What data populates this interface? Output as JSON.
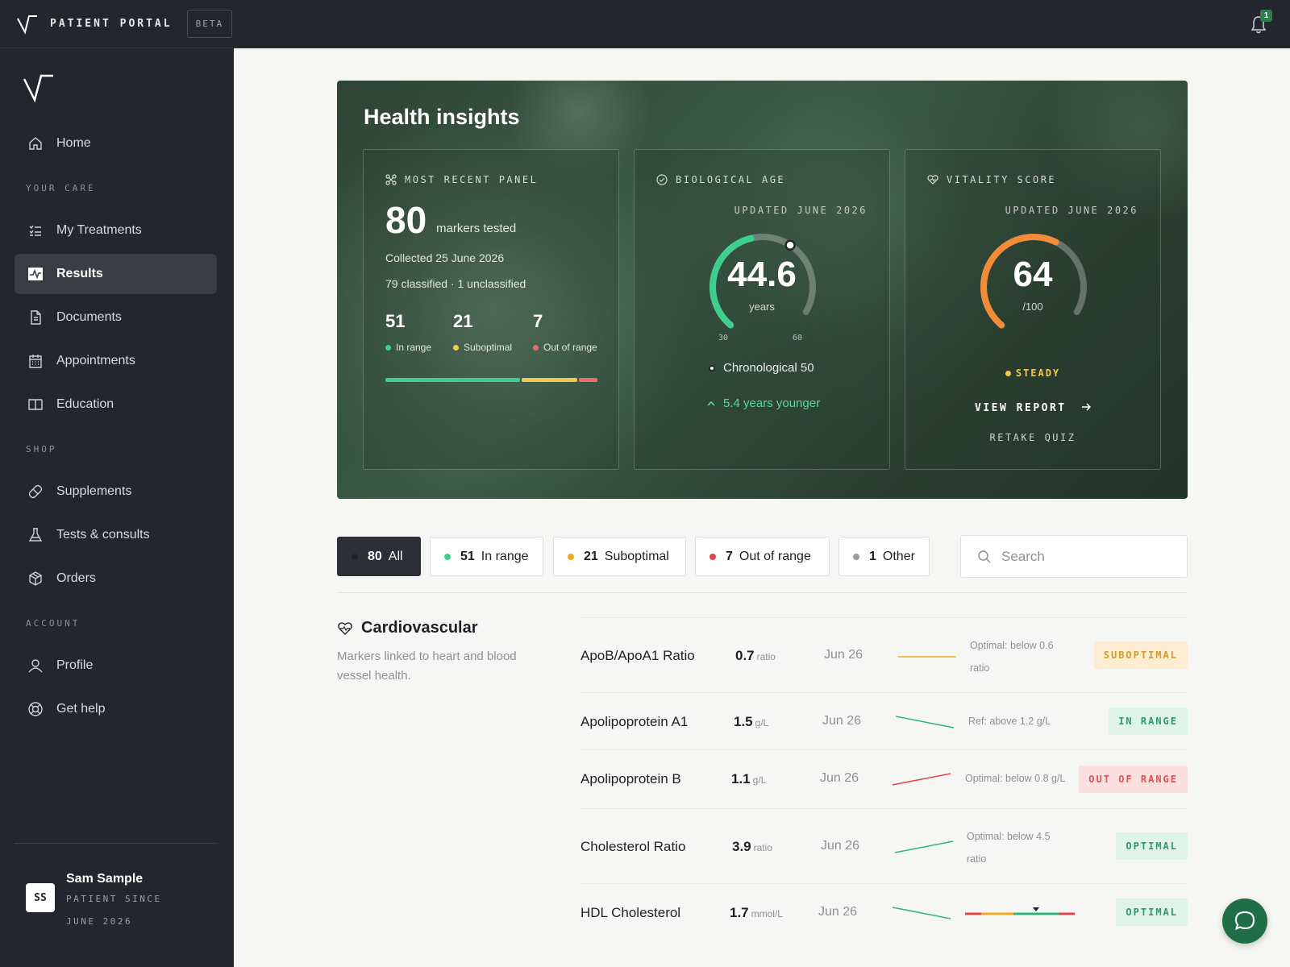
{
  "topbar": {
    "brand": "PATIENT PORTAL",
    "beta": "BETA",
    "notifications": "1"
  },
  "sidebar": {
    "items": [
      {
        "label": "Home",
        "icon": "home-icon"
      },
      {
        "label": "My Treatments",
        "icon": "list-icon"
      },
      {
        "label": "Results",
        "icon": "activity-icon",
        "active": true
      },
      {
        "label": "Documents",
        "icon": "document-icon"
      },
      {
        "label": "Appointments",
        "icon": "calendar-icon"
      },
      {
        "label": "Education",
        "icon": "book-icon"
      },
      {
        "label": "Supplements",
        "icon": "pill-icon"
      },
      {
        "label": "Tests & consults",
        "icon": "flask-icon"
      },
      {
        "label": "Orders",
        "icon": "box-icon"
      },
      {
        "label": "Profile",
        "icon": "user-icon"
      },
      {
        "label": "Get help",
        "icon": "lifebuoy-icon"
      }
    ],
    "sections": [
      "YOUR CARE",
      "SHOP",
      "ACCOUNT"
    ],
    "user": {
      "initials": "SS",
      "name": "Sam Sample",
      "since": "PATIENT SINCE JUNE 2026"
    }
  },
  "hero": {
    "title": "Health insights",
    "panel": {
      "header": "MOST RECENT PANEL",
      "count": "80",
      "count_label": "markers tested",
      "collected": "Collected 25 June 2026",
      "classified": "79 classified · 1 unclassified",
      "stats": [
        {
          "value": "51",
          "label": "In range",
          "color": "#3ecf8e"
        },
        {
          "value": "21",
          "label": "Suboptimal",
          "color": "#f2c94c"
        },
        {
          "value": "7",
          "label": "Out of range",
          "color": "#eb6b6b"
        }
      ]
    },
    "bio_age": {
      "header": "BIOLOGICAL AGE",
      "updated": "UPDATED JUNE 2026",
      "value": "44.6",
      "unit": "years",
      "min": "30",
      "max": "60",
      "chronological": "Chronological 50",
      "younger": "5.4 years younger",
      "gauge_fraction": 0.487,
      "color": "#3ecf8e"
    },
    "vitality": {
      "header": "VITALITY SCORE",
      "updated": "UPDATED JUNE 2026",
      "value": "64",
      "unit": "/100",
      "status": "STEADY",
      "view_report": "VIEW REPORT",
      "retake": "RETAKE QUIZ",
      "gauge_fraction": 0.64,
      "color": "#f28c38"
    }
  },
  "filters": [
    {
      "count": "80",
      "label": "All",
      "color": "#1d2026",
      "active": true
    },
    {
      "count": "51",
      "label": "In range",
      "color": "#3ecf8e"
    },
    {
      "count": "21",
      "label": "Suboptimal",
      "color": "#f0a81e"
    },
    {
      "count": "7",
      "label": "Out of range",
      "color": "#e0454c"
    },
    {
      "count": "1",
      "label": "Other",
      "color": "#9a9ea4"
    }
  ],
  "search": {
    "placeholder": "Search"
  },
  "category": {
    "title": "Cardiovascular",
    "description": "Markers linked to heart and blood vessel health.",
    "markers": [
      {
        "name": "ApoB/ApoA1 Ratio",
        "value": "0.7",
        "unit": "ratio",
        "date": "Jun 26",
        "ref": "Optimal: below 0.6 ratio",
        "status": "SUBOPTIMAL"
      },
      {
        "name": "Apolipoprotein A1",
        "value": "1.5",
        "unit": "g/L",
        "date": "Jun 26",
        "ref": "Ref: above 1.2 g/L",
        "status": "IN RANGE"
      },
      {
        "name": "Apolipoprotein B",
        "value": "1.1",
        "unit": "g/L",
        "date": "Jun 26",
        "ref": "Optimal: below 0.8 g/L",
        "status": "OUT OF RANGE"
      },
      {
        "name": "Cholesterol Ratio",
        "value": "3.9",
        "unit": "ratio",
        "date": "Jun 26",
        "ref": "Optimal: below 4.5 ratio",
        "status": "OPTIMAL"
      },
      {
        "name": "HDL Cholesterol",
        "value": "1.7",
        "unit": "mmol/L",
        "date": "Jun 26",
        "ref": "",
        "status": "OPTIMAL"
      }
    ]
  }
}
